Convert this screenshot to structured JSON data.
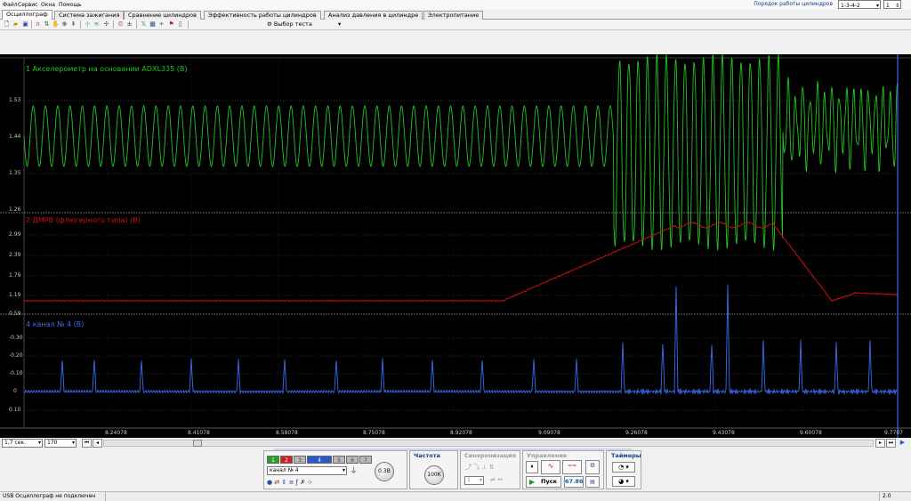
{
  "menu": [
    "Файл",
    "Сервис",
    "Окна",
    "Помощь"
  ],
  "cylinder_order": {
    "label": "Порядок работы цилиндров",
    "value": "1-3-4-2",
    "count": "1"
  },
  "tabs": [
    "Осциллограф",
    "Система зажигания",
    "Сравнение цилиндров",
    "Эффективность работы цилиндров",
    "Анализ давления в цилиндре",
    "Электропитание"
  ],
  "toolbar": {
    "test_select_label": "Выбор теста"
  },
  "channels": [
    {
      "title": "1 Акселерометр на основании ADXL335 (В)",
      "color": "#22c422",
      "ticks": [
        "1.53",
        "1.44",
        "1.35",
        "1.26"
      ]
    },
    {
      "title": "2 ДМРВ (флюгерного типа) (В)",
      "color": "#d01010",
      "ticks": [
        "2.99",
        "2.39",
        "1.79",
        "1.19",
        "0.59"
      ]
    },
    {
      "title": "4  канал № 4 (В)",
      "color": "#3a6cf0",
      "ticks": [
        "-0.30",
        "-0.20",
        "-0.10",
        "0",
        "0.10"
      ]
    }
  ],
  "time_axis": [
    "8.24078",
    "8.41078",
    "8.58078",
    "8.75078",
    "8.92078",
    "9.09078",
    "9.26078",
    "9.43078",
    "9.60078",
    "9.7707"
  ],
  "scroll": {
    "time_per_div": "1,7 сек.",
    "zoom": "170"
  },
  "controls": {
    "channel_buttons": [
      "1",
      "2",
      "3",
      "4",
      "5",
      "6",
      "7"
    ],
    "channel_select": "канал № 4",
    "volts_knob": "0.3В",
    "freq_title": "Частота",
    "freq_knob": "100K",
    "sync_title": "Синхронизация",
    "sync_channel": "1",
    "control_title": "Управление",
    "start_label": "Пуск",
    "rate_value": "67.86",
    "timers_title": "Таймеры"
  },
  "status": {
    "message": "USB Осциллограф не подключен",
    "version": "2.0"
  },
  "colors": {
    "ch1": "#22c422",
    "ch2": "#d01010",
    "ch4": "#3a6cf0",
    "bg": "#000000"
  }
}
